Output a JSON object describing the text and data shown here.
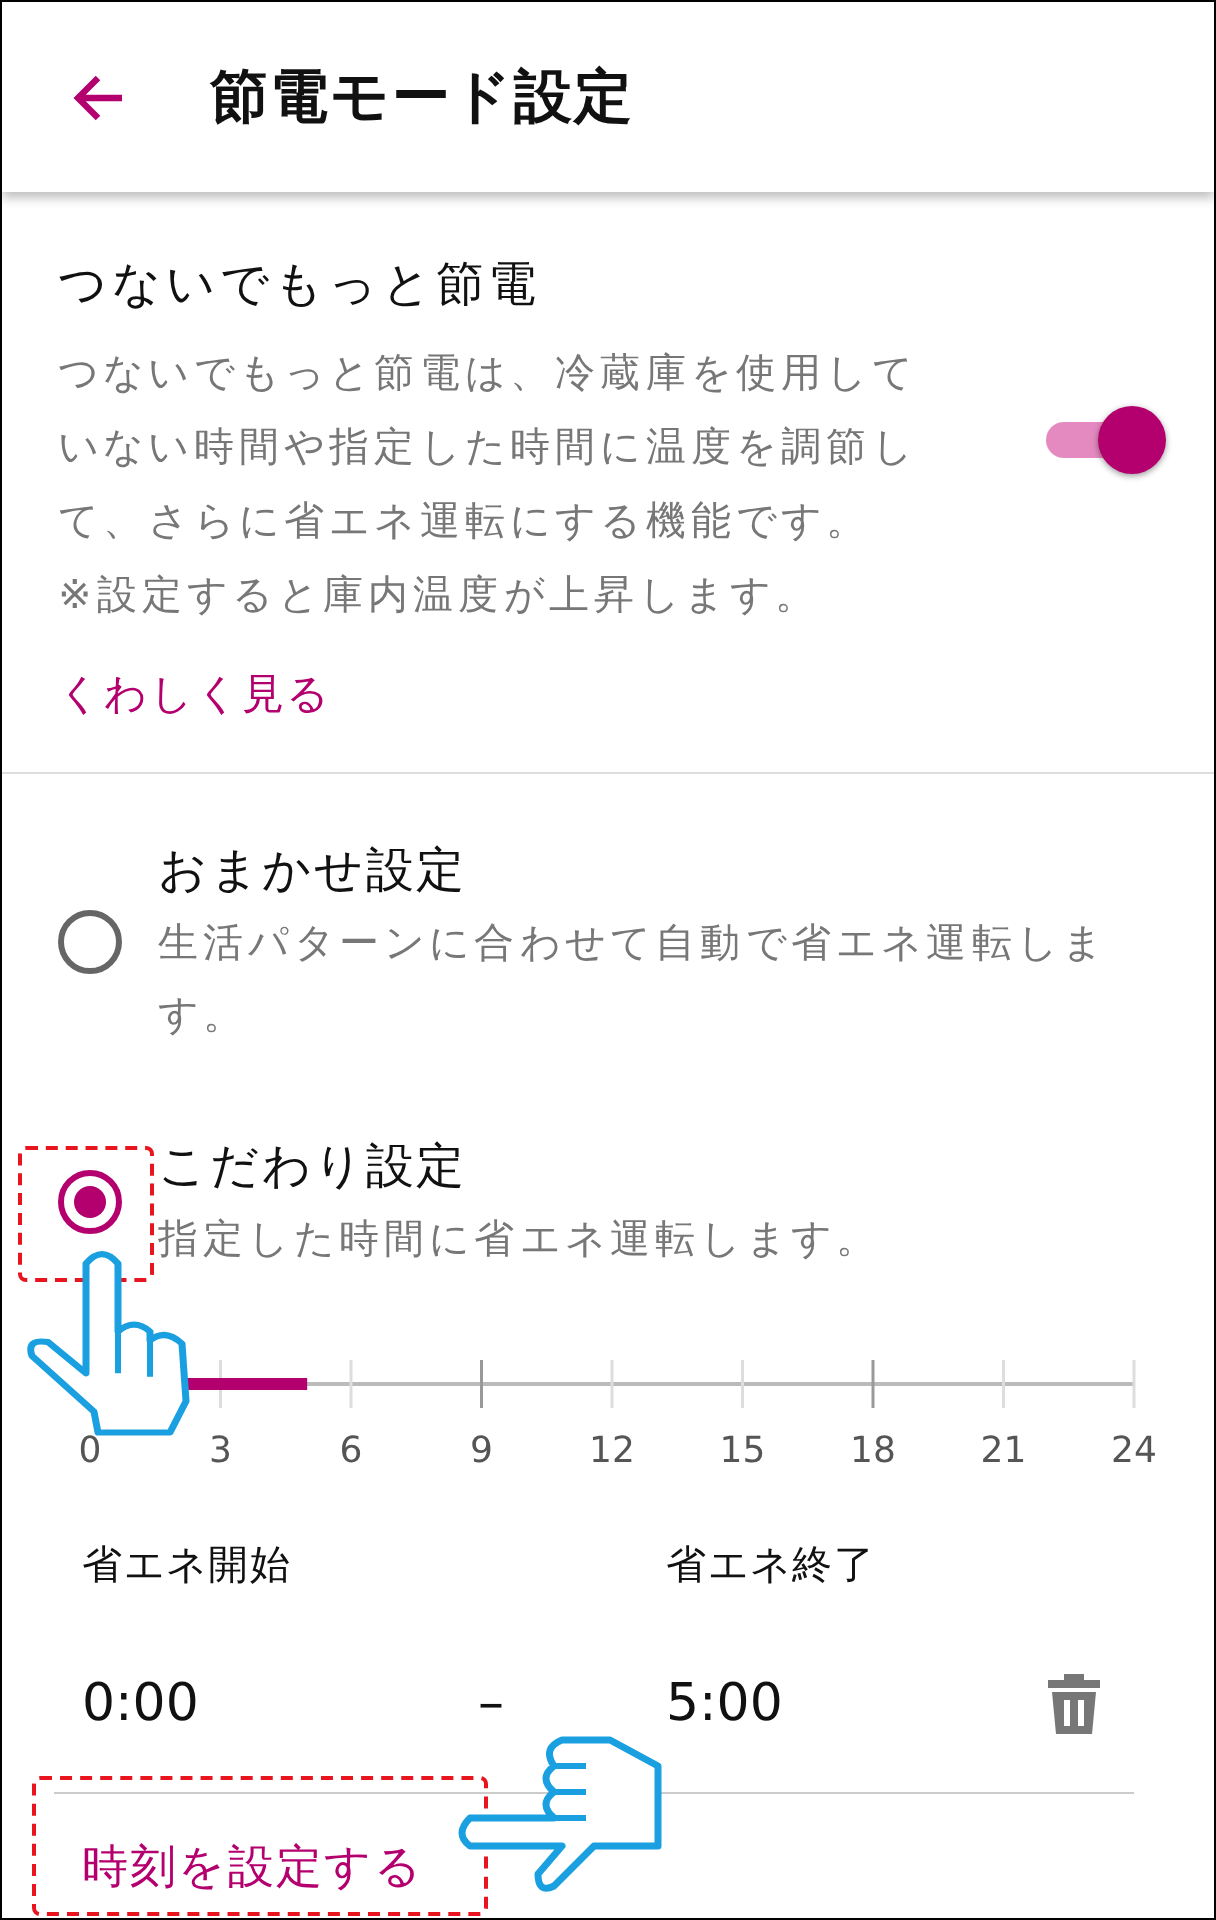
{
  "header": {
    "title": "節電モード設定"
  },
  "eco_connect": {
    "title": "つないでもっと節電",
    "description": "つないでもっと節電は、冷蔵庫を使用していない時間や指定した時間に温度を調節して、さらに省エネ運転にする機能です。",
    "note": "※設定すると庫内温度が上昇します。",
    "on": true,
    "link": "くわしく見る"
  },
  "modes": [
    {
      "title": "おまかせ設定",
      "description": "生活パターンに合わせて自動で省エネ運転します。",
      "selected": false
    },
    {
      "title": "こだわり設定",
      "description": "指定した時間に省エネ運転します。",
      "selected": true
    }
  ],
  "timeline": {
    "ticks": [
      "0",
      "3",
      "6",
      "9",
      "12",
      "15",
      "18",
      "21",
      "24"
    ],
    "level": 0.208
  },
  "schedule": {
    "start_label": "省エネ開始",
    "end_label": "省エネ終了",
    "start": "0:00",
    "separator": "–",
    "end": "5:00"
  },
  "set_time_link": "時刻を設定する"
}
